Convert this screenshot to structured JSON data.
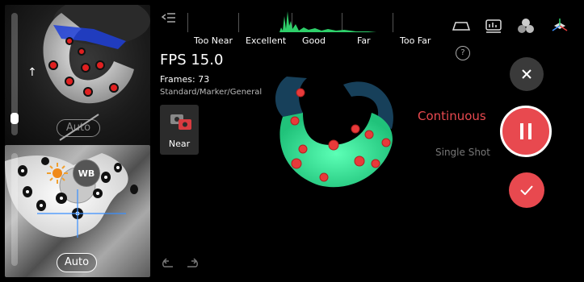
{
  "camera_panels": {
    "top": {
      "auto_label": "Auto",
      "auto_disabled": true,
      "exposure_level": 0.1
    },
    "bottom": {
      "wb_label": "WB",
      "auto_label": "Auto"
    }
  },
  "distance_bar": {
    "labels": [
      "Too Near",
      "Excellent",
      "Good",
      "Far",
      "Too Far"
    ]
  },
  "status": {
    "fps": "FPS 15.0",
    "frames": "Frames: 73",
    "mode_path": "Standard/Marker/General"
  },
  "near_button": {
    "label": "Near"
  },
  "scan_mode": {
    "continuous_label": "Continuous",
    "single_shot_label": "Single Shot",
    "active": "Continuous"
  },
  "colors": {
    "accent_red": "#e8494f",
    "histogram_green": "#2ecf6a",
    "scan_green": "#3ff0a0"
  },
  "icons": {
    "menu": "collapse-menu-icon",
    "help": "help-icon",
    "close": "close-icon",
    "pause": "pause-icon",
    "confirm": "check-icon",
    "undo": "undo-icon",
    "redo": "redo-icon"
  }
}
